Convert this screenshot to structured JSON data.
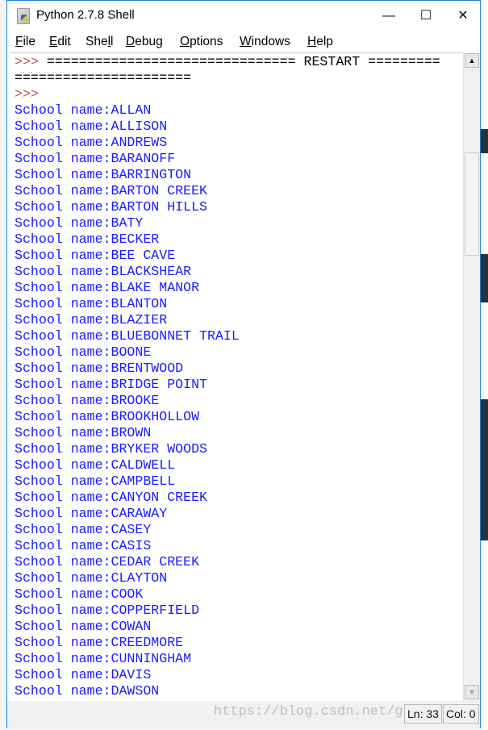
{
  "window": {
    "title": "Python 2.7.8 Shell",
    "minimize": "—",
    "maximize": "☐",
    "close": "✕"
  },
  "menu": [
    "File",
    "Edit",
    "Shell",
    "Debug",
    "Options",
    "Windows",
    "Help"
  ],
  "shell": {
    "restart_line1": ">>> =============================== RESTART =========",
    "restart_line2": "======================",
    "prompt": ">>>",
    "output_prefix": "School name:",
    "schools": [
      "ALLAN",
      "ALLISON",
      "ANDREWS",
      "BARANOFF",
      "BARRINGTON",
      "BARTON CREEK",
      "BARTON HILLS",
      "BATY",
      "BECKER",
      "BEE CAVE",
      "BLACKSHEAR",
      "BLAKE MANOR",
      "BLANTON",
      "BLAZIER",
      "BLUEBONNET TRAIL",
      "BOONE",
      "BRENTWOOD",
      "BRIDGE POINT",
      "BROOKE",
      "BROOKHOLLOW",
      "BROWN",
      "BRYKER WOODS",
      "CALDWELL",
      "CAMPBELL",
      "CANYON CREEK",
      "CARAWAY",
      "CASEY",
      "CASIS",
      "CEDAR CREEK",
      "CLAYTON",
      "COOK",
      "COPPERFIELD",
      "COWAN",
      "CREEDMORE",
      "CUNNINGHAM",
      "DAVIS",
      "DAWSON"
    ]
  },
  "status": {
    "line": "Ln: 33",
    "col": "Col: 0"
  },
  "watermark": "https://blog.csdn.net/g",
  "colors": {
    "prompt": "#c0504d",
    "output": "#1a1aff",
    "border": "#1883d7"
  }
}
